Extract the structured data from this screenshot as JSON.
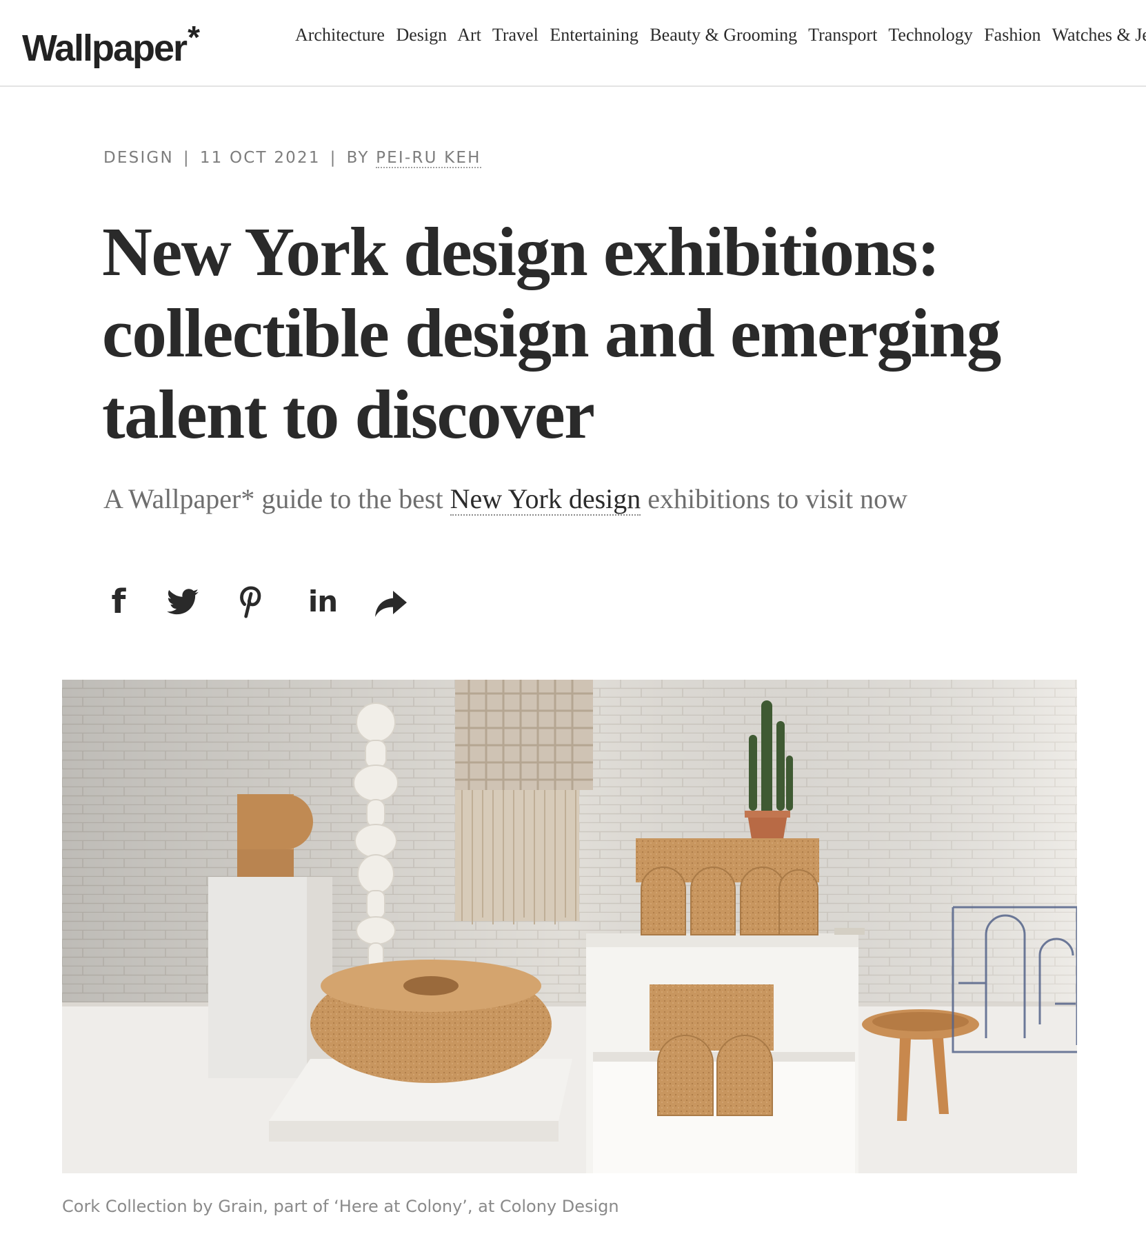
{
  "header": {
    "logo": "Wallpaper",
    "logo_star": "*",
    "nav": [
      "Architecture",
      "Design",
      "Art",
      "Travel",
      "Entertaining",
      "Beauty & Grooming",
      "Transport",
      "Technology",
      "Fashion",
      "Watches & Jew"
    ]
  },
  "article": {
    "category": "DESIGN",
    "separator": "|",
    "date": "11 OCT 2021",
    "by": "BY",
    "author": "PEI-RU KEH",
    "headline": "New York design exhibitions: collectible design and emerging talent to discover",
    "standfirst_before": "A Wallpaper* guide to the best ",
    "standfirst_link": "New York design",
    "standfirst_after": " exhibitions to visit now",
    "caption": "Cork Collection by Grain, part of ‘Here at Colony’, at Colony Design"
  },
  "share": {
    "icons": [
      "facebook-icon",
      "twitter-icon",
      "pinterest-icon",
      "linkedin-icon",
      "share-arrow-icon"
    ],
    "facebook_glyph": "f",
    "linkedin_glyph": "in"
  },
  "colors": {
    "text": "#2b2b2b",
    "meta": "#7d7d7d",
    "cork": "#c99a67",
    "wall": "#e9e6e1",
    "plinth": "#f4f3f1"
  }
}
